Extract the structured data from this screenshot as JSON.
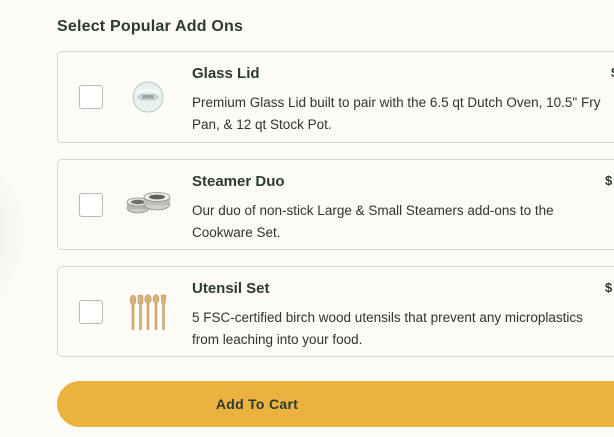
{
  "section": {
    "title": "Select Popular Add Ons"
  },
  "addons": [
    {
      "name": "Glass Lid",
      "description": "Premium Glass Lid built to pair with the 6.5 qt Dutch Oven, 10.5\" Fry Pan, & 12 qt Stock Pot.",
      "price": "$",
      "checked": false,
      "icon": "glass-lid-icon"
    },
    {
      "name": "Steamer Duo",
      "description": "Our duo of non-stick Large & Small Steamers add-ons to the Cookware Set.",
      "price": "$",
      "checked": false,
      "icon": "steamer-duo-icon"
    },
    {
      "name": "Utensil Set",
      "description": "5 FSC-certified birch wood utensils that prevent any microplastics from leaching into your food.",
      "price": "$",
      "checked": false,
      "icon": "utensil-set-icon"
    }
  ],
  "cart_button": {
    "label": "Add To Cart",
    "color": "#ecb23f"
  }
}
